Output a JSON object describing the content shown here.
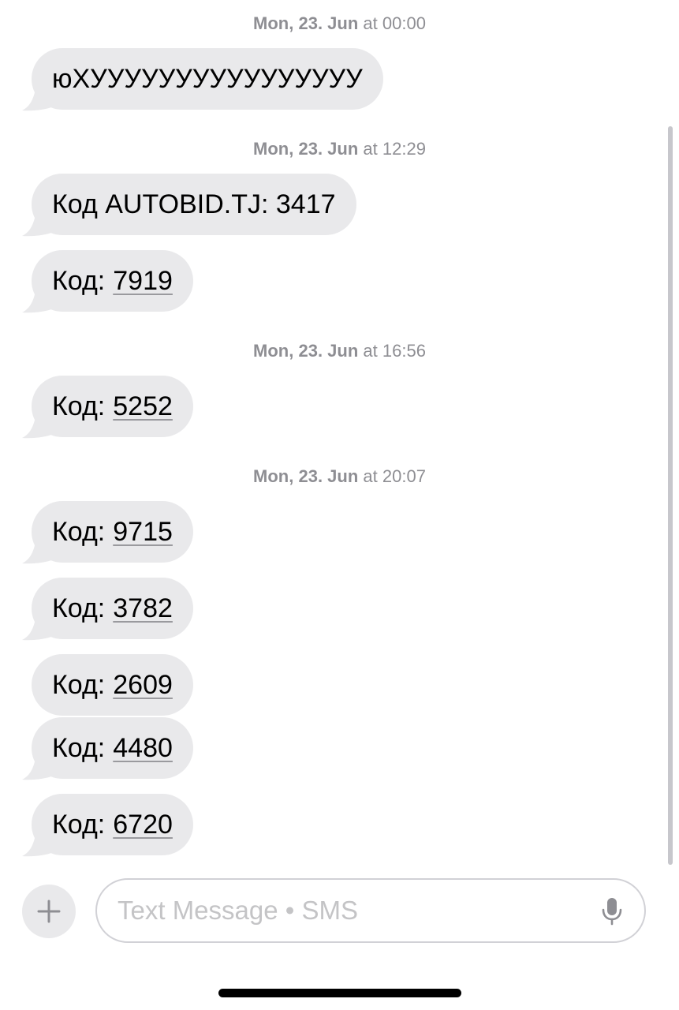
{
  "thread": [
    {
      "type": "timestamp",
      "day": "Mon, 23. Jun",
      "time": "at 00:00"
    },
    {
      "type": "message",
      "text": "юХУУУУУУУУУУУУУУУУ"
    },
    {
      "type": "timestamp",
      "day": "Mon, 23. Jun",
      "time": "at 12:29"
    },
    {
      "type": "message",
      "text": "Код AUTOBID.TJ: 3417"
    },
    {
      "type": "message",
      "prefix": "Код:",
      "code": "7919"
    },
    {
      "type": "timestamp",
      "day": "Mon, 23. Jun",
      "time": "at 16:56"
    },
    {
      "type": "message",
      "prefix": "Код:",
      "code": "5252"
    },
    {
      "type": "timestamp",
      "day": "Mon, 23. Jun",
      "time": "at 20:07"
    },
    {
      "type": "message",
      "prefix": "Код:",
      "code": "9715"
    },
    {
      "type": "message",
      "prefix": "Код:",
      "code": "3782"
    },
    {
      "type": "message",
      "prefix": "Код:",
      "code": "2609"
    },
    {
      "type": "message",
      "prefix": "Код:",
      "code": "4480"
    },
    {
      "type": "message",
      "prefix": "Код:",
      "code": "6720"
    }
  ],
  "composer": {
    "add_icon": "plus-icon",
    "placeholder": "Text Message • SMS",
    "mic_icon": "microphone-icon"
  },
  "colors": {
    "bubble": "#e9e9eb",
    "timestamp": "#8e8e93",
    "placeholder": "#c4c4c6"
  }
}
